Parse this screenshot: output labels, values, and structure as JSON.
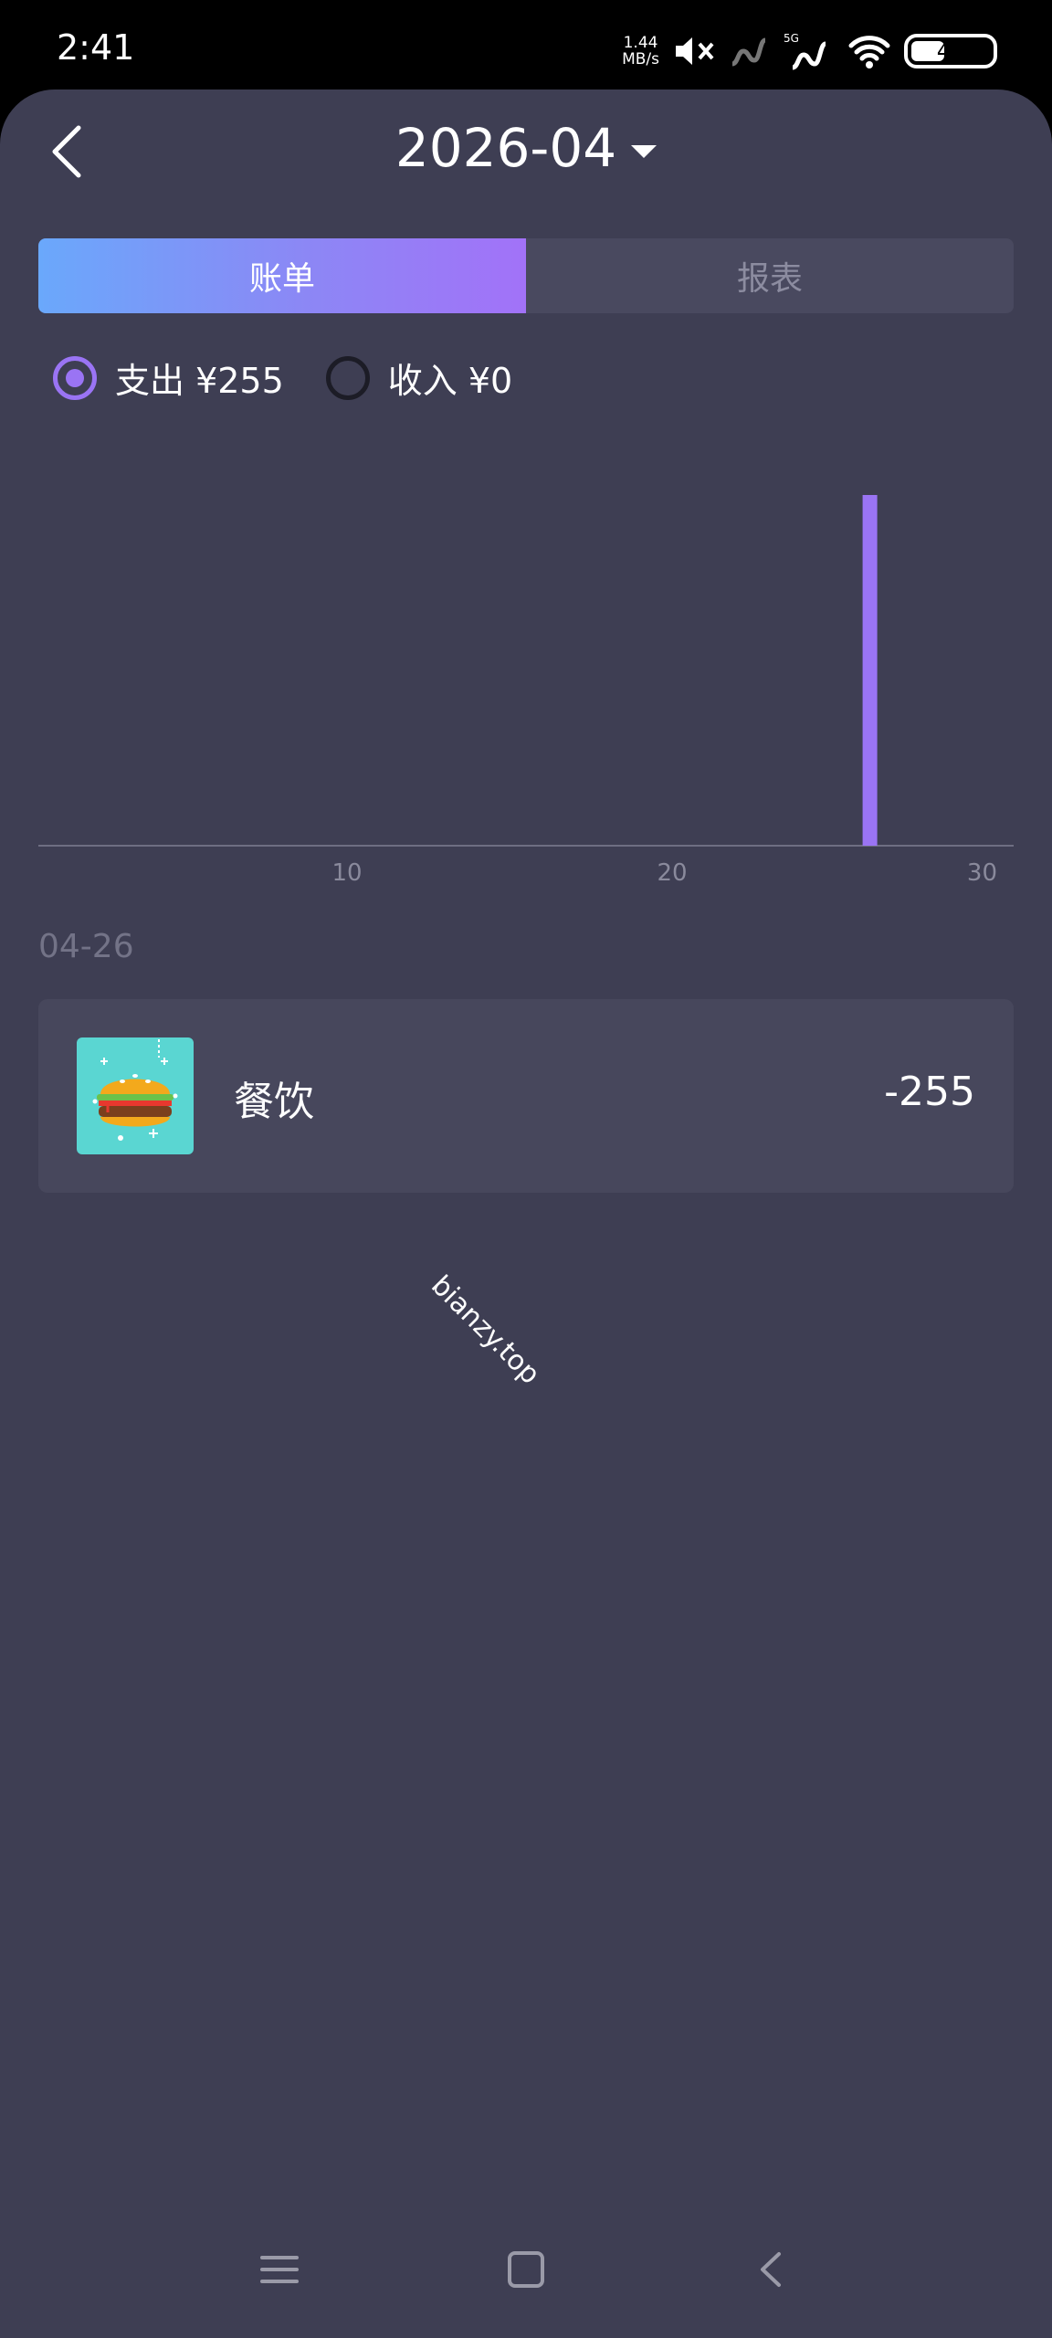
{
  "status_bar": {
    "time": "2:41",
    "net_speed_value": "1.44",
    "net_speed_unit": "MB/s",
    "network_type": "5G",
    "battery": "41"
  },
  "header": {
    "title": "2026-04",
    "back_icon": "chevron-left-icon",
    "dropdown_icon": "caret-down-icon"
  },
  "tabs": [
    {
      "label": "账单",
      "active": true
    },
    {
      "label": "报表",
      "active": false
    }
  ],
  "filters": [
    {
      "label": "支出 ¥255",
      "selected": true
    },
    {
      "label": "收入 ¥0",
      "selected": false
    }
  ],
  "chart_data": {
    "type": "bar",
    "x": [
      26
    ],
    "values": [
      255
    ],
    "xlim": [
      0,
      30
    ],
    "xticks": [
      10,
      20,
      30
    ],
    "ylim": [
      0,
      255
    ],
    "bar_color": "#9a74f4",
    "grid": false
  },
  "records": [
    {
      "date": "04-26",
      "category": "餐饮",
      "amount": "-255",
      "icon": "burger-icon"
    }
  ],
  "watermark": "bianzy.top",
  "colors": {
    "accent": "#9a74f4",
    "tab_gradient_start": "#6aa8fb",
    "tab_gradient_end": "#a272f8",
    "background": "#3e3e53"
  }
}
